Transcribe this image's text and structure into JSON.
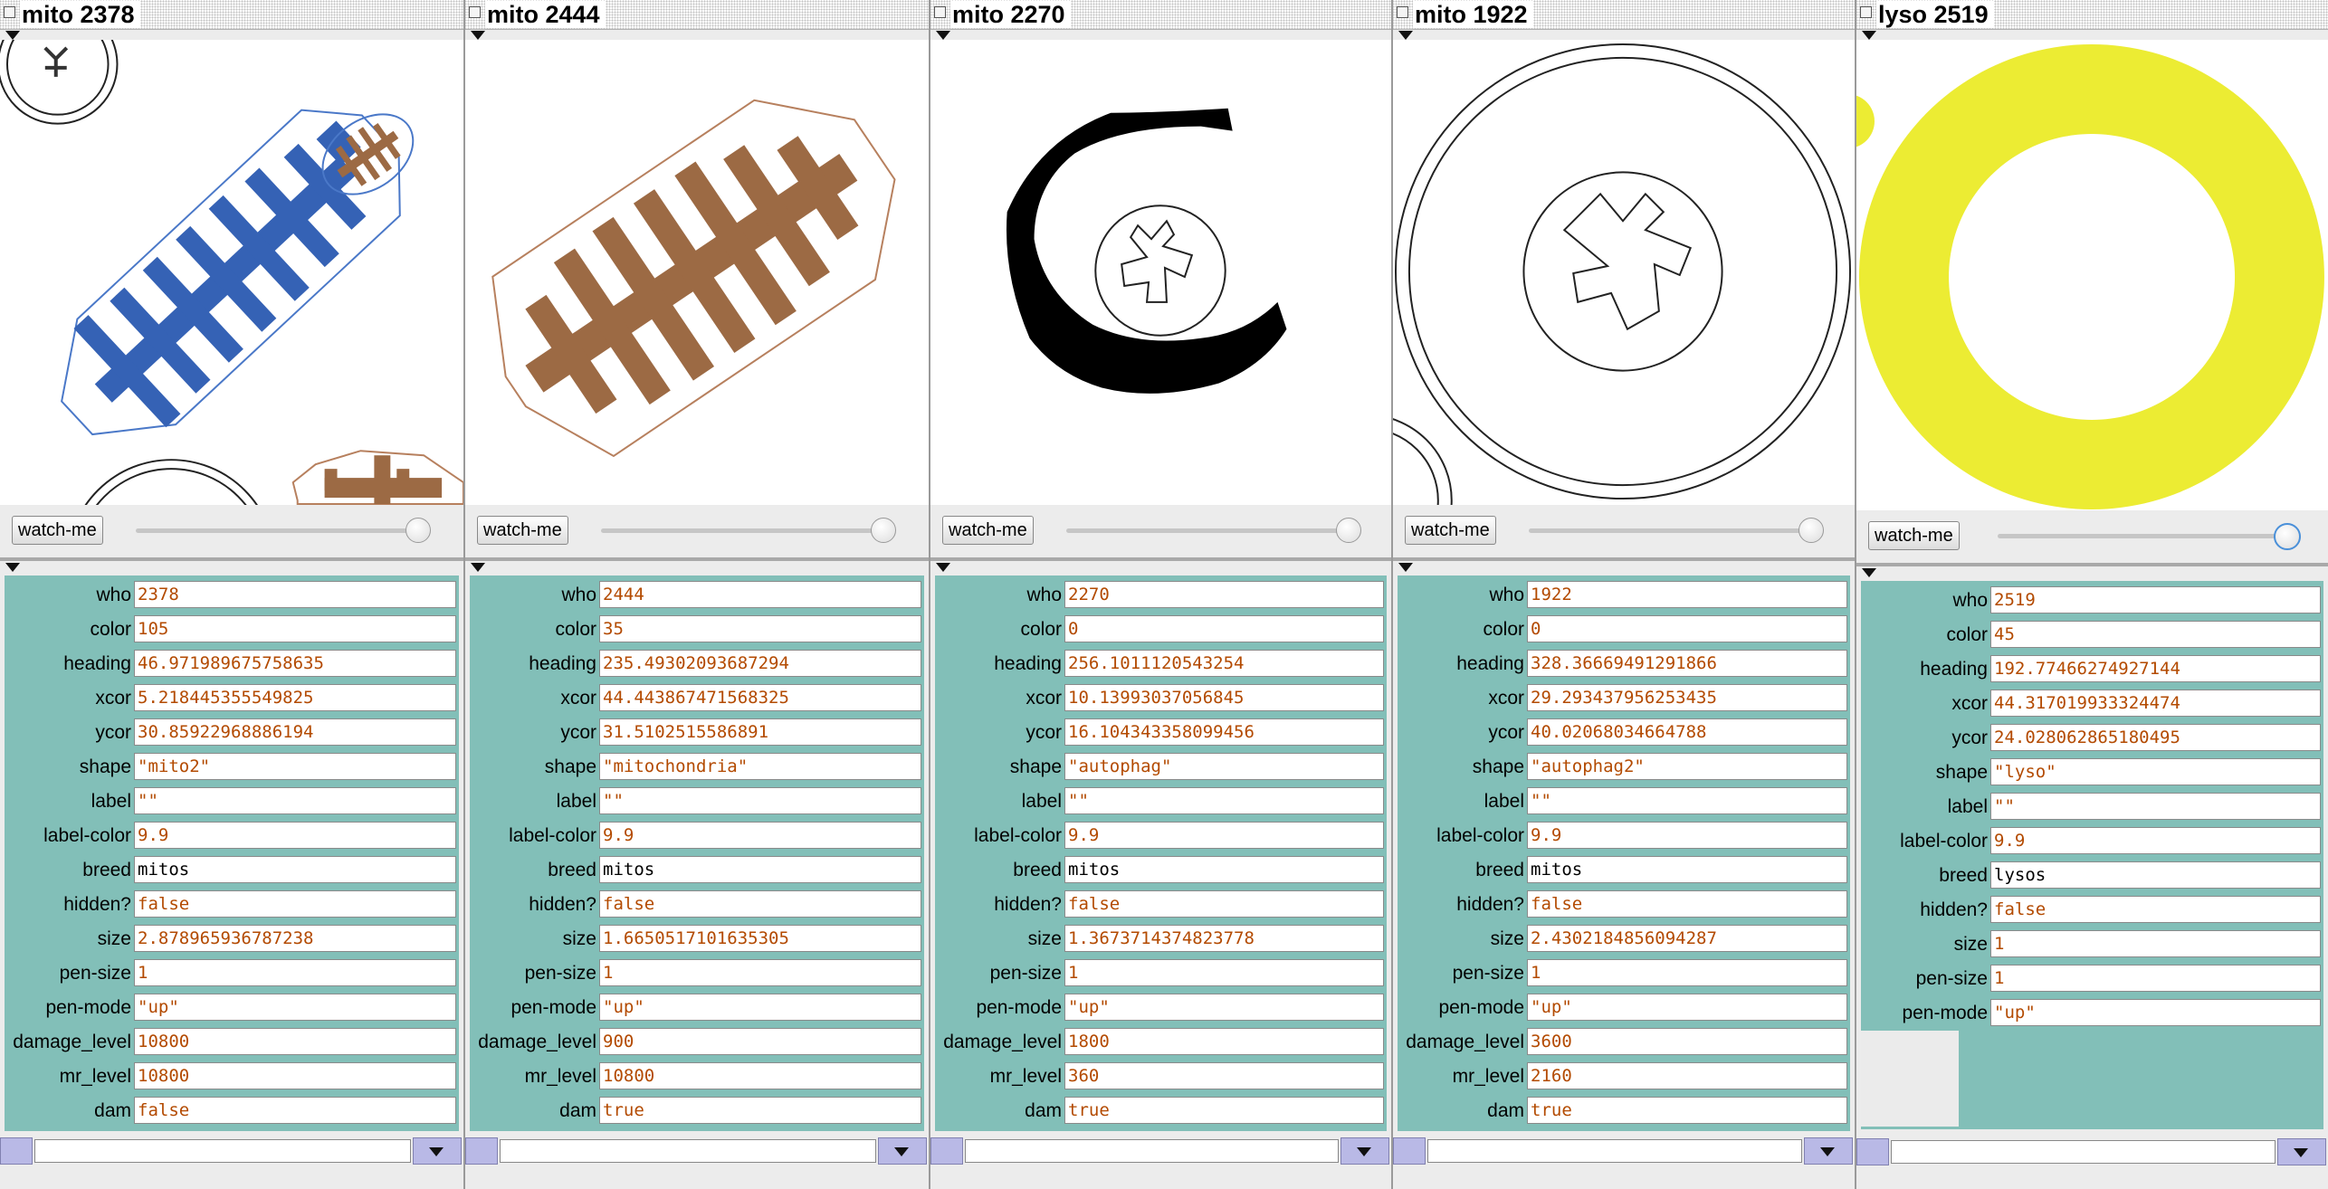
{
  "monitors": [
    {
      "title": "mito 2378",
      "watch_label": "watch-me",
      "fields": [
        {
          "label": "who",
          "value": "2378"
        },
        {
          "label": "color",
          "value": "105"
        },
        {
          "label": "heading",
          "value": "46.971989675758635"
        },
        {
          "label": "xcor",
          "value": "5.218445355549825"
        },
        {
          "label": "ycor",
          "value": "30.85922968886194"
        },
        {
          "label": "shape",
          "value": "\"mito2\""
        },
        {
          "label": "label",
          "value": "\"\""
        },
        {
          "label": "label-color",
          "value": "9.9"
        },
        {
          "label": "breed",
          "value": "mitos"
        },
        {
          "label": "hidden?",
          "value": "false"
        },
        {
          "label": "size",
          "value": "2.878965936787238"
        },
        {
          "label": "pen-size",
          "value": "1"
        },
        {
          "label": "pen-mode",
          "value": "\"up\""
        },
        {
          "label": "damage_level",
          "value": "10800"
        },
        {
          "label": "mr_level",
          "value": "10800"
        },
        {
          "label": "dam",
          "value": "false"
        }
      ]
    },
    {
      "title": "mito 2444",
      "watch_label": "watch-me",
      "fields": [
        {
          "label": "who",
          "value": "2444"
        },
        {
          "label": "color",
          "value": "35"
        },
        {
          "label": "heading",
          "value": "235.49302093687294"
        },
        {
          "label": "xcor",
          "value": "44.443867471568325"
        },
        {
          "label": "ycor",
          "value": "31.5102515586891"
        },
        {
          "label": "shape",
          "value": "\"mitochondria\""
        },
        {
          "label": "label",
          "value": "\"\""
        },
        {
          "label": "label-color",
          "value": "9.9"
        },
        {
          "label": "breed",
          "value": "mitos"
        },
        {
          "label": "hidden?",
          "value": "false"
        },
        {
          "label": "size",
          "value": "1.6650517101635305"
        },
        {
          "label": "pen-size",
          "value": "1"
        },
        {
          "label": "pen-mode",
          "value": "\"up\""
        },
        {
          "label": "damage_level",
          "value": "900"
        },
        {
          "label": "mr_level",
          "value": "10800"
        },
        {
          "label": "dam",
          "value": "true"
        }
      ]
    },
    {
      "title": "mito 2270",
      "watch_label": "watch-me",
      "fields": [
        {
          "label": "who",
          "value": "2270"
        },
        {
          "label": "color",
          "value": "0"
        },
        {
          "label": "heading",
          "value": "256.1011120543254"
        },
        {
          "label": "xcor",
          "value": "10.13993037056845"
        },
        {
          "label": "ycor",
          "value": "16.104343358099456"
        },
        {
          "label": "shape",
          "value": "\"autophag\""
        },
        {
          "label": "label",
          "value": "\"\""
        },
        {
          "label": "label-color",
          "value": "9.9"
        },
        {
          "label": "breed",
          "value": "mitos"
        },
        {
          "label": "hidden?",
          "value": "false"
        },
        {
          "label": "size",
          "value": "1.3673714374823778"
        },
        {
          "label": "pen-size",
          "value": "1"
        },
        {
          "label": "pen-mode",
          "value": "\"up\""
        },
        {
          "label": "damage_level",
          "value": "1800"
        },
        {
          "label": "mr_level",
          "value": "360"
        },
        {
          "label": "dam",
          "value": "true"
        }
      ]
    },
    {
      "title": "mito 1922",
      "watch_label": "watch-me",
      "fields": [
        {
          "label": "who",
          "value": "1922"
        },
        {
          "label": "color",
          "value": "0"
        },
        {
          "label": "heading",
          "value": "328.36669491291866"
        },
        {
          "label": "xcor",
          "value": "29.293437956253435"
        },
        {
          "label": "ycor",
          "value": "40.02068034664788"
        },
        {
          "label": "shape",
          "value": "\"autophag2\""
        },
        {
          "label": "label",
          "value": "\"\""
        },
        {
          "label": "label-color",
          "value": "9.9"
        },
        {
          "label": "breed",
          "value": "mitos"
        },
        {
          "label": "hidden?",
          "value": "false"
        },
        {
          "label": "size",
          "value": "2.4302184856094287"
        },
        {
          "label": "pen-size",
          "value": "1"
        },
        {
          "label": "pen-mode",
          "value": "\"up\""
        },
        {
          "label": "damage_level",
          "value": "3600"
        },
        {
          "label": "mr_level",
          "value": "2160"
        },
        {
          "label": "dam",
          "value": "true"
        }
      ]
    },
    {
      "title": "lyso 2519",
      "watch_label": "watch-me",
      "fields": [
        {
          "label": "who",
          "value": "2519"
        },
        {
          "label": "color",
          "value": "45"
        },
        {
          "label": "heading",
          "value": "192.77466274927144"
        },
        {
          "label": "xcor",
          "value": "44.317019933324474"
        },
        {
          "label": "ycor",
          "value": "24.028062865180495"
        },
        {
          "label": "shape",
          "value": "\"lyso\""
        },
        {
          "label": "label",
          "value": "\"\""
        },
        {
          "label": "label-color",
          "value": "9.9"
        },
        {
          "label": "breed",
          "value": "lysos"
        },
        {
          "label": "hidden?",
          "value": "false"
        },
        {
          "label": "size",
          "value": "1"
        },
        {
          "label": "pen-size",
          "value": "1"
        },
        {
          "label": "pen-mode",
          "value": "\"up\""
        }
      ]
    }
  ],
  "colors": {
    "inspector_bg": "#82bfb8",
    "value_text": "#b34a00",
    "mito_blue": "#3562b5",
    "mito_brown": "#9c6a44",
    "lyso_yellow": "#ecec33",
    "command_bar": "#b9b9e6"
  }
}
